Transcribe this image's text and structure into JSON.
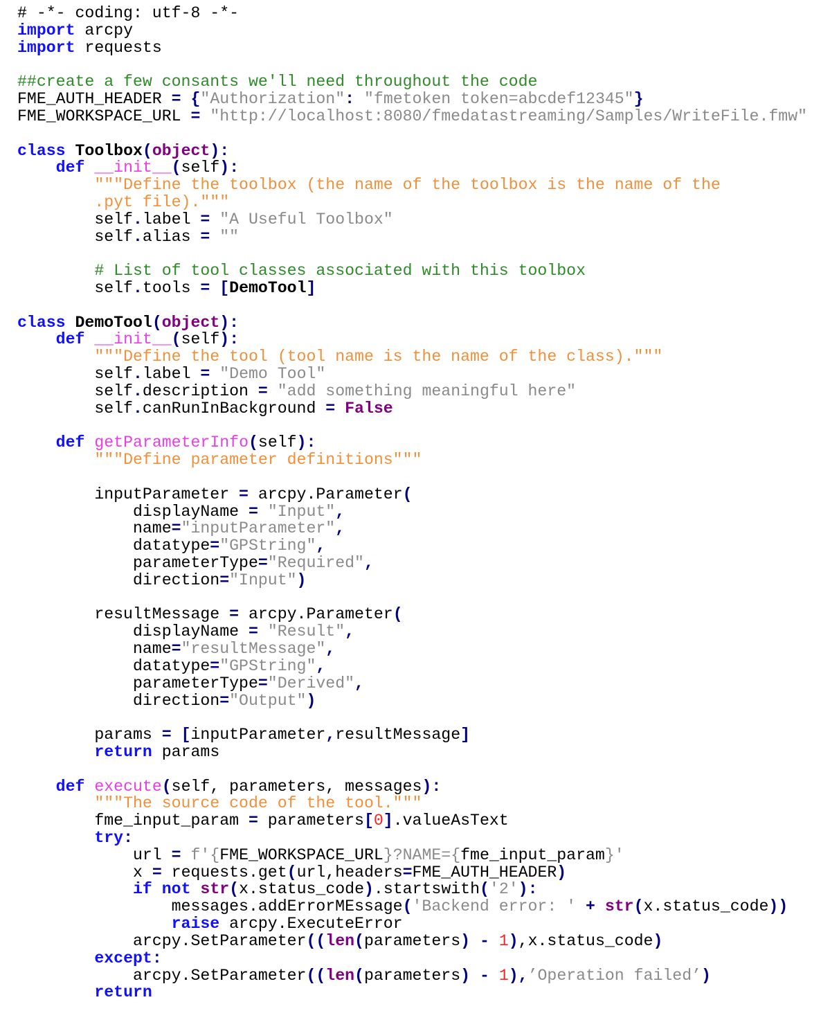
{
  "document": {
    "language": "python",
    "lines": [
      [
        [
          "# -*- coding: utf-8 -*-",
          "pl"
        ]
      ],
      [
        [
          "import",
          "kw"
        ],
        [
          " arcpy",
          "pl"
        ]
      ],
      [
        [
          "import",
          "kw"
        ],
        [
          " requests",
          "pl"
        ]
      ],
      [],
      [
        [
          "##create a few consants we'll need throughout the code",
          "cm"
        ]
      ],
      [
        [
          "FME_AUTH_HEADER ",
          "pl"
        ],
        [
          "=",
          "op"
        ],
        [
          " ",
          "pl"
        ],
        [
          "{",
          "op"
        ],
        [
          "\"Authorization\"",
          "str"
        ],
        [
          ":",
          "op"
        ],
        [
          " ",
          "pl"
        ],
        [
          "\"fmetoken token=abcdef12345\"",
          "str"
        ],
        [
          "}",
          "op"
        ]
      ],
      [
        [
          "FME_WORKSPACE_URL ",
          "pl"
        ],
        [
          "=",
          "op"
        ],
        [
          " ",
          "pl"
        ],
        [
          "\"http://localhost:8080/fmedatastreaming/Samples/WriteFile.fmw\"",
          "str"
        ]
      ],
      [],
      [
        [
          "class",
          "kw"
        ],
        [
          " ",
          "pl"
        ],
        [
          "Toolbox",
          "cls"
        ],
        [
          "(",
          "op"
        ],
        [
          "object",
          "bi"
        ],
        [
          ")",
          "op"
        ],
        [
          ":",
          "op"
        ]
      ],
      [
        [
          "    ",
          "pl"
        ],
        [
          "def",
          "kw"
        ],
        [
          " ",
          "pl"
        ],
        [
          "__init__",
          "fn"
        ],
        [
          "(",
          "op"
        ],
        [
          "self",
          "pl"
        ],
        [
          ")",
          "op"
        ],
        [
          ":",
          "op"
        ]
      ],
      [
        [
          "        ",
          "pl"
        ],
        [
          "\"\"\"Define the toolbox (the name of the toolbox is the name of the",
          "doc"
        ]
      ],
      [
        [
          "        ",
          "pl"
        ],
        [
          ".pyt file).\"\"\"",
          "doc"
        ]
      ],
      [
        [
          "        self",
          "pl"
        ],
        [
          ".",
          "op"
        ],
        [
          "label ",
          "pl"
        ],
        [
          "=",
          "op"
        ],
        [
          " ",
          "pl"
        ],
        [
          "\"A Useful Toolbox\"",
          "str"
        ]
      ],
      [
        [
          "        self",
          "pl"
        ],
        [
          ".",
          "op"
        ],
        [
          "alias ",
          "pl"
        ],
        [
          "=",
          "op"
        ],
        [
          " ",
          "pl"
        ],
        [
          "\"\"",
          "str"
        ]
      ],
      [],
      [
        [
          "        ",
          "pl"
        ],
        [
          "# List of tool classes associated with this toolbox",
          "cm"
        ]
      ],
      [
        [
          "        self",
          "pl"
        ],
        [
          ".",
          "op"
        ],
        [
          "tools ",
          "pl"
        ],
        [
          "=",
          "op"
        ],
        [
          " ",
          "pl"
        ],
        [
          "[",
          "op"
        ],
        [
          "DemoTool",
          "cls"
        ],
        [
          "]",
          "op"
        ]
      ],
      [],
      [
        [
          "class",
          "kw"
        ],
        [
          " ",
          "pl"
        ],
        [
          "DemoTool",
          "cls"
        ],
        [
          "(",
          "op"
        ],
        [
          "object",
          "bi"
        ],
        [
          ")",
          "op"
        ],
        [
          ":",
          "op"
        ]
      ],
      [
        [
          "    ",
          "pl"
        ],
        [
          "def",
          "kw"
        ],
        [
          " ",
          "pl"
        ],
        [
          "__init__",
          "fn"
        ],
        [
          "(",
          "op"
        ],
        [
          "self",
          "pl"
        ],
        [
          ")",
          "op"
        ],
        [
          ":",
          "op"
        ]
      ],
      [
        [
          "        ",
          "pl"
        ],
        [
          "\"\"\"Define the tool (tool name is the name of the class).\"\"\"",
          "doc"
        ]
      ],
      [
        [
          "        self",
          "pl"
        ],
        [
          ".",
          "op"
        ],
        [
          "label ",
          "pl"
        ],
        [
          "=",
          "op"
        ],
        [
          " ",
          "pl"
        ],
        [
          "\"Demo Tool\"",
          "str"
        ]
      ],
      [
        [
          "        self",
          "pl"
        ],
        [
          ".",
          "op"
        ],
        [
          "description ",
          "pl"
        ],
        [
          "=",
          "op"
        ],
        [
          " ",
          "pl"
        ],
        [
          "\"add something meaningful here\"",
          "str"
        ]
      ],
      [
        [
          "        self",
          "pl"
        ],
        [
          ".",
          "op"
        ],
        [
          "canRunInBackground ",
          "pl"
        ],
        [
          "=",
          "op"
        ],
        [
          " ",
          "pl"
        ],
        [
          "False",
          "bi"
        ]
      ],
      [],
      [
        [
          "    ",
          "pl"
        ],
        [
          "def",
          "kw"
        ],
        [
          " ",
          "pl"
        ],
        [
          "getParameterInfo",
          "fn"
        ],
        [
          "(",
          "op"
        ],
        [
          "self",
          "pl"
        ],
        [
          ")",
          "op"
        ],
        [
          ":",
          "op"
        ]
      ],
      [
        [
          "        ",
          "pl"
        ],
        [
          "\"\"\"Define parameter definitions\"\"\"",
          "doc"
        ]
      ],
      [],
      [
        [
          "        inputParameter ",
          "pl"
        ],
        [
          "=",
          "op"
        ],
        [
          " arcpy.Parameter",
          "pl"
        ],
        [
          "(",
          "op"
        ]
      ],
      [
        [
          "            displayName ",
          "pl"
        ],
        [
          "=",
          "op"
        ],
        [
          " ",
          "pl"
        ],
        [
          "\"Input\"",
          "str"
        ],
        [
          ",",
          "op"
        ]
      ],
      [
        [
          "            name",
          "pl"
        ],
        [
          "=",
          "op"
        ],
        [
          "\"inputParameter\"",
          "str"
        ],
        [
          ",",
          "op"
        ]
      ],
      [
        [
          "            datatype",
          "pl"
        ],
        [
          "=",
          "op"
        ],
        [
          "\"GPString\"",
          "str"
        ],
        [
          ",",
          "op"
        ]
      ],
      [
        [
          "            parameterType",
          "pl"
        ],
        [
          "=",
          "op"
        ],
        [
          "\"Required\"",
          "str"
        ],
        [
          ",",
          "op"
        ]
      ],
      [
        [
          "            direction",
          "pl"
        ],
        [
          "=",
          "op"
        ],
        [
          "\"Input\"",
          "str"
        ],
        [
          ")",
          "op"
        ]
      ],
      [],
      [
        [
          "        resultMessage ",
          "pl"
        ],
        [
          "=",
          "op"
        ],
        [
          " arcpy.Parameter",
          "pl"
        ],
        [
          "(",
          "op"
        ]
      ],
      [
        [
          "            displayName ",
          "pl"
        ],
        [
          "=",
          "op"
        ],
        [
          " ",
          "pl"
        ],
        [
          "\"Result\"",
          "str"
        ],
        [
          ",",
          "op"
        ]
      ],
      [
        [
          "            name",
          "pl"
        ],
        [
          "=",
          "op"
        ],
        [
          "\"resultMessage\"",
          "str"
        ],
        [
          ",",
          "op"
        ]
      ],
      [
        [
          "            datatype",
          "pl"
        ],
        [
          "=",
          "op"
        ],
        [
          "\"GPString\"",
          "str"
        ],
        [
          ",",
          "op"
        ]
      ],
      [
        [
          "            parameterType",
          "pl"
        ],
        [
          "=",
          "op"
        ],
        [
          "\"Derived\"",
          "str"
        ],
        [
          ",",
          "op"
        ]
      ],
      [
        [
          "            direction",
          "pl"
        ],
        [
          "=",
          "op"
        ],
        [
          "\"Output\"",
          "str"
        ],
        [
          ")",
          "op"
        ]
      ],
      [],
      [
        [
          "        params ",
          "pl"
        ],
        [
          "=",
          "op"
        ],
        [
          " ",
          "pl"
        ],
        [
          "[",
          "op"
        ],
        [
          "inputParameter",
          "pl"
        ],
        [
          ",",
          "op"
        ],
        [
          "resultMessage",
          "pl"
        ],
        [
          "]",
          "op"
        ]
      ],
      [
        [
          "        ",
          "pl"
        ],
        [
          "return",
          "kw"
        ],
        [
          " params",
          "pl"
        ]
      ],
      [],
      [
        [
          "    ",
          "pl"
        ],
        [
          "def",
          "kw"
        ],
        [
          " ",
          "pl"
        ],
        [
          "execute",
          "fn"
        ],
        [
          "(",
          "op"
        ],
        [
          "self, parameters, messages",
          "pl"
        ],
        [
          ")",
          "op"
        ],
        [
          ":",
          "op"
        ]
      ],
      [
        [
          "        ",
          "pl"
        ],
        [
          "\"\"\"The source code of the tool.\"\"\"",
          "doc"
        ]
      ],
      [
        [
          "        fme_input_param ",
          "pl"
        ],
        [
          "=",
          "op"
        ],
        [
          " parameters",
          "pl"
        ],
        [
          "[",
          "op"
        ],
        [
          "0",
          "num"
        ],
        [
          "]",
          "op"
        ],
        [
          ".valueAsText",
          "pl"
        ]
      ],
      [
        [
          "        ",
          "pl"
        ],
        [
          "try",
          "kw"
        ],
        [
          ":",
          "op"
        ]
      ],
      [
        [
          "            url ",
          "pl"
        ],
        [
          "=",
          "op"
        ],
        [
          " ",
          "pl"
        ],
        [
          "f'{",
          "str"
        ],
        [
          "FME_WORKSPACE_URL",
          "pl"
        ],
        [
          "}?NAME={",
          "str"
        ],
        [
          "fme_input_param",
          "pl"
        ],
        [
          "}'",
          "str"
        ]
      ],
      [
        [
          "            x ",
          "pl"
        ],
        [
          "=",
          "op"
        ],
        [
          " requests.get",
          "pl"
        ],
        [
          "(",
          "op"
        ],
        [
          "url,headers",
          "pl"
        ],
        [
          "=",
          "op"
        ],
        [
          "FME_AUTH_HEADER",
          "pl"
        ],
        [
          ")",
          "op"
        ]
      ],
      [
        [
          "            ",
          "pl"
        ],
        [
          "if",
          "kw"
        ],
        [
          " ",
          "pl"
        ],
        [
          "not",
          "kw"
        ],
        [
          " ",
          "pl"
        ],
        [
          "str",
          "bi"
        ],
        [
          "(",
          "op"
        ],
        [
          "x.status_code",
          "pl"
        ],
        [
          ")",
          "op"
        ],
        [
          ".startswith",
          "pl"
        ],
        [
          "(",
          "op"
        ],
        [
          "'2'",
          "str"
        ],
        [
          ")",
          "op"
        ],
        [
          ":",
          "op"
        ]
      ],
      [
        [
          "                messages.addErrorMEssage",
          "pl"
        ],
        [
          "(",
          "op"
        ],
        [
          "'Backend error: '",
          "str"
        ],
        [
          " ",
          "pl"
        ],
        [
          "+",
          "op"
        ],
        [
          " ",
          "pl"
        ],
        [
          "str",
          "bi"
        ],
        [
          "(",
          "op"
        ],
        [
          "x.status_code",
          "pl"
        ],
        [
          "))",
          "op"
        ]
      ],
      [
        [
          "                ",
          "pl"
        ],
        [
          "raise",
          "kw"
        ],
        [
          " arcpy.ExecuteError",
          "pl"
        ]
      ],
      [
        [
          "            arcpy.SetParameter",
          "pl"
        ],
        [
          "((",
          "op"
        ],
        [
          "len",
          "bi"
        ],
        [
          "(",
          "op"
        ],
        [
          "parameters",
          "pl"
        ],
        [
          ")",
          "op"
        ],
        [
          " ",
          "pl"
        ],
        [
          "-",
          "op"
        ],
        [
          " ",
          "pl"
        ],
        [
          "1",
          "num"
        ],
        [
          ")",
          "op"
        ],
        [
          ",x.status_code",
          "pl"
        ],
        [
          ")",
          "op"
        ]
      ],
      [
        [
          "        ",
          "pl"
        ],
        [
          "except",
          "kw"
        ],
        [
          ":",
          "op"
        ]
      ],
      [
        [
          "            arcpy.SetParameter",
          "pl"
        ],
        [
          "((",
          "op"
        ],
        [
          "len",
          "bi"
        ],
        [
          "(",
          "op"
        ],
        [
          "parameters",
          "pl"
        ],
        [
          ")",
          "op"
        ],
        [
          " ",
          "pl"
        ],
        [
          "-",
          "op"
        ],
        [
          " ",
          "pl"
        ],
        [
          "1",
          "num"
        ],
        [
          ")",
          "op"
        ],
        [
          ",",
          "op"
        ],
        [
          "’Operation failed’",
          "str"
        ],
        [
          ")",
          "op"
        ]
      ],
      [
        [
          "        ",
          "pl"
        ],
        [
          "return",
          "kw"
        ]
      ]
    ]
  }
}
